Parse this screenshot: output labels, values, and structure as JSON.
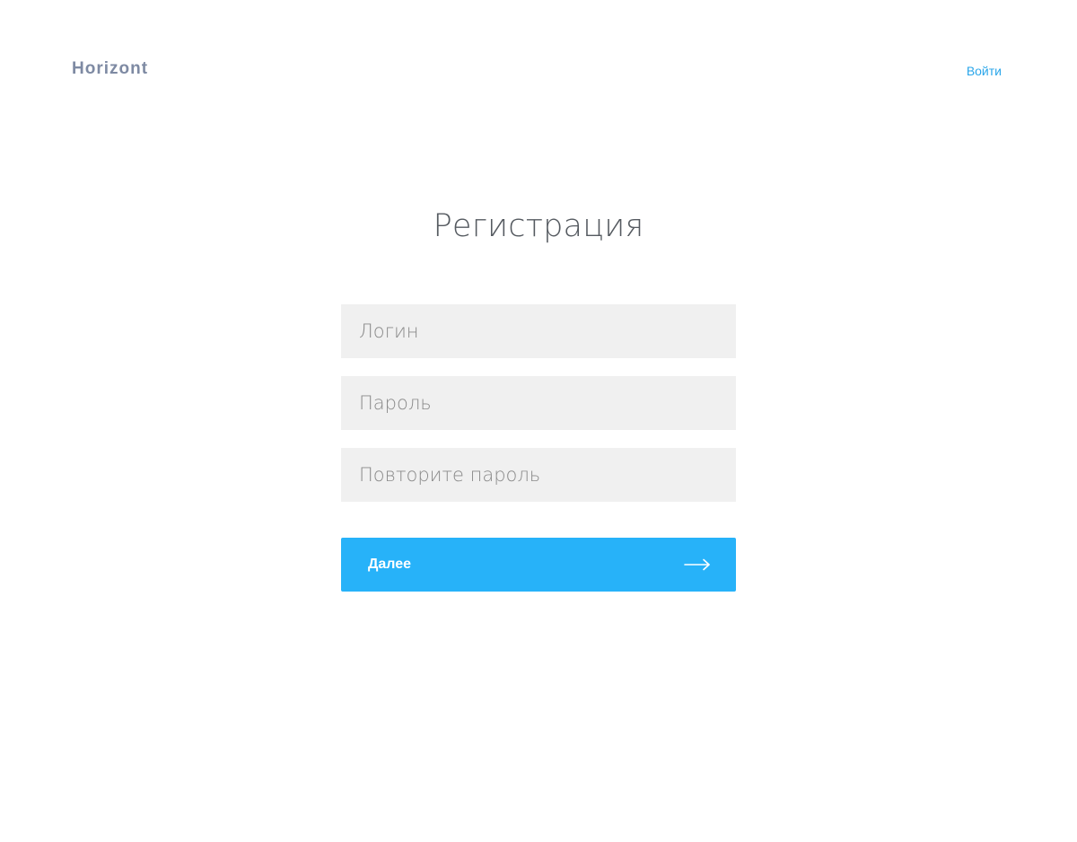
{
  "header": {
    "logo": "Horizont",
    "login_link": "Войти"
  },
  "main": {
    "title": "Регистрация",
    "fields": [
      {
        "placeholder": "Логин",
        "value": ""
      },
      {
        "placeholder": "Пароль",
        "value": ""
      },
      {
        "placeholder": "Повторите пароль",
        "value": ""
      }
    ],
    "submit": {
      "label": "Далее",
      "icon": "arrow-right-icon"
    }
  },
  "colors": {
    "accent": "#27b2f9",
    "link": "#2aa6ea",
    "logo": "#7e8aa3",
    "field_bg": "#f0f0f0",
    "title": "#555a60"
  }
}
